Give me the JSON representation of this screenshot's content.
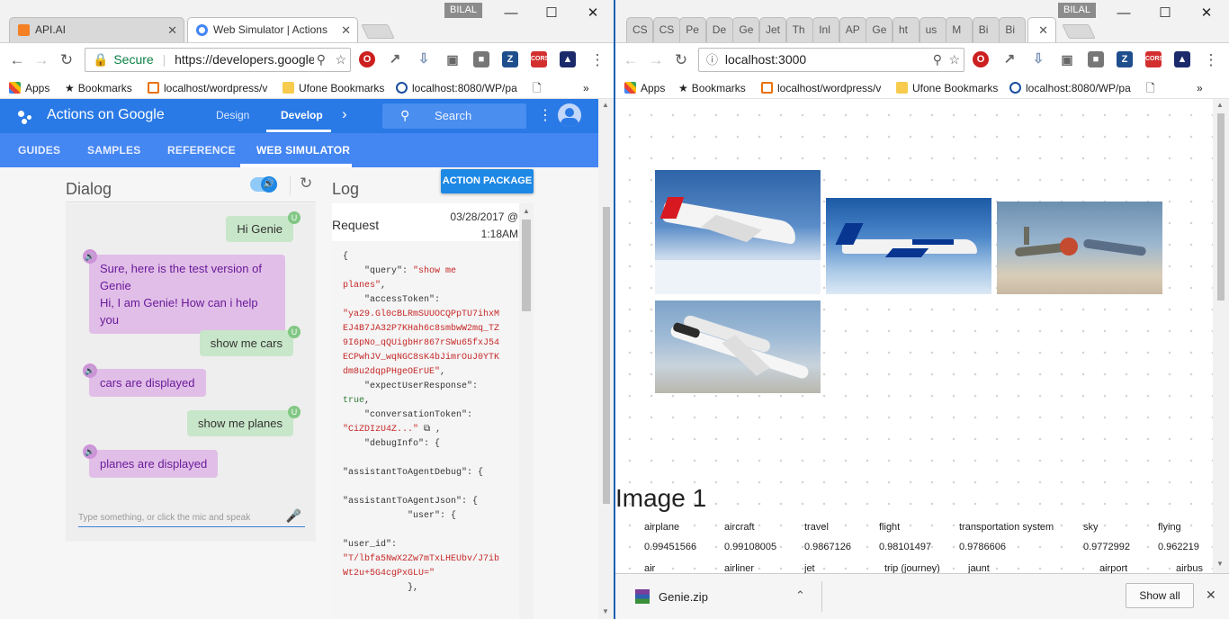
{
  "left": {
    "window_user": "BILAL",
    "tabs": [
      {
        "title": "API.AI",
        "color": "#f48024"
      },
      {
        "title": "Web Simulator  |  Actions",
        "color": "#4285f4"
      }
    ],
    "address": {
      "secure": "Secure",
      "url": "https://developers.google"
    },
    "bookmarks": [
      "Apps",
      "Bookmarks",
      "localhost/wordpress/v",
      "Ufone Bookmarks",
      "localhost:8080/WP/pa"
    ],
    "header": {
      "brand": "Actions on Google",
      "tab_design": "Design",
      "tab_develop": "Develop",
      "search": "Search"
    },
    "nav": [
      "GUIDES",
      "SAMPLES",
      "REFERENCE",
      "WEB SIMULATOR"
    ],
    "action_package": "ACTION PACKAGE",
    "dialog": {
      "title": "Dialog",
      "badge_user": "U",
      "user_messages": [
        "Hi Genie",
        "show me cars",
        "show me planes"
      ],
      "assistant_messages": {
        "welcome_1": "Sure, here is the test version of",
        "welcome_2": "Genie",
        "welcome_3": "Hi, I am Genie! How can i help you",
        "cars": "cars are displayed",
        "planes": "planes are displayed"
      },
      "input_placeholder": "Type something, or click the mic and speak"
    },
    "log": {
      "title": "Log",
      "request_label": "Request",
      "date": "03/28/2017 @",
      "time": "1:18AM",
      "code": {
        "l1": "{",
        "query_key": "    \"query\": ",
        "query_val1": "\"show me",
        "query_val2": "planes\"",
        "token_key": "    \"accessToken\":",
        "token1": "\"ya29.Gl0cBLRmSUUOCQPpTU7ihxM",
        "token2": "EJ4B7JA32P7KHah6c8smbwW2mq_TZ",
        "token3": "9I6pNo_qQUigbHr867rSWu65fxJ54",
        "token4": "ECPwhJV_wqNGC8sK4bJimrOuJ0YTK",
        "token5": "dm8u2dqpPHgeOErUE\"",
        "expect_key": "    \"expectUserResponse\":",
        "expect_val": "true",
        "conv_key": "    \"conversationToken\":",
        "conv_val": "\"CiZDIzU4Z...\"",
        "debug_key": "    \"debugInfo\": {",
        "atad": "\"assistantToAgentDebug\": {",
        "atajson": "\"assistantToAgentJson\": {",
        "user": "            \"user\": {",
        "userid_key": "\"user_id\":",
        "userid1": "\"T/lbfa5NwX2Zw7mTxLHEUbv/J7ib",
        "userid2": "Wt2u+5G4cgPxGLU=\"",
        "close": "            },"
      }
    }
  },
  "right": {
    "window_user": "BILAL",
    "tabs": [
      "CS",
      "CS",
      "Pe",
      "De",
      "Ge",
      "Jet",
      "Th",
      "Inl",
      "AP",
      "Ge",
      "ht",
      "us",
      "M",
      "Bi",
      "Bi"
    ],
    "url": "localhost:3000",
    "bookmarks": [
      "Apps",
      "Bookmarks",
      "localhost/wordpress/v",
      "Ufone Bookmarks",
      "localhost:8080/WP/pa"
    ],
    "image_title": "Image 1",
    "labels": [
      "airplane",
      "aircraft",
      "travel",
      "flight",
      "transportation system",
      "sky",
      "flying"
    ],
    "scores": [
      "0.99451566",
      "0.99108005",
      "0.9867126",
      "0.98101497",
      "0.9786606",
      "0.9772992",
      "0.962219"
    ],
    "labels_row2": [
      "air",
      "airliner",
      "jet",
      "trip (journey)",
      "jaunt",
      "airport",
      "airbus"
    ],
    "download": {
      "file": "Genie.zip",
      "show_all": "Show all"
    }
  }
}
